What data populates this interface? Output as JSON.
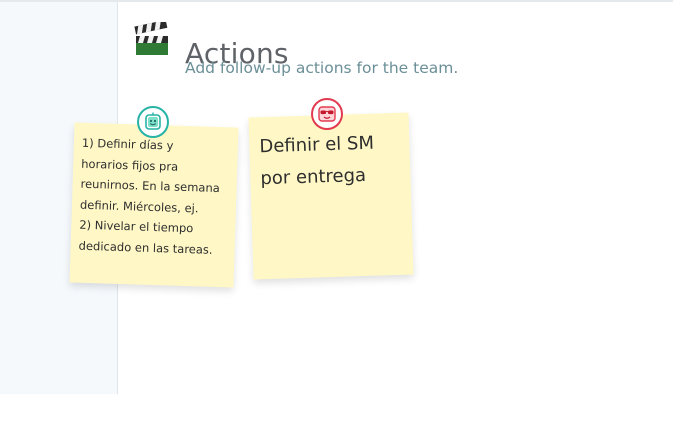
{
  "header": {
    "title": "Actions",
    "subtitle": "Add follow-up actions for the team.",
    "icon": "clapperboard-icon"
  },
  "notes": [
    {
      "text": "1) Definir días y\nhorarios fijos pra\nreunirnos. En la semana\ndefinir. Miércoles, ej.\n2) Nivelar el tiempo\ndedicado en las tareas.",
      "avatar_icon": "robot-face-icon",
      "avatar_color": "#27b3a6"
    },
    {
      "text": "Definir el SM\npor entrega",
      "avatar_icon": "sunglasses-face-icon",
      "avatar_color": "#e23b4f"
    }
  ],
  "colors": {
    "sticky_note": "#fff8c6",
    "sidebar": "#f5f9fc",
    "title": "#5f6368",
    "subtitle": "#6b8f97"
  }
}
